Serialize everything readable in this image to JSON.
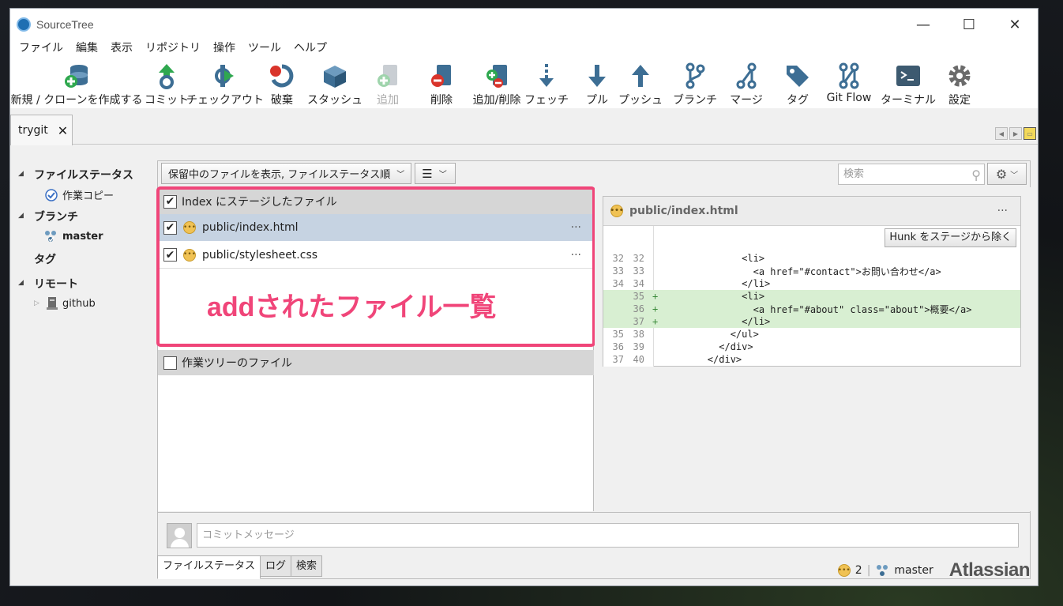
{
  "window": {
    "title": "SourceTree",
    "minimize": "—",
    "maximize": "☐",
    "close": "✕"
  },
  "menu": [
    "ファイル",
    "編集",
    "表示",
    "リポジトリ",
    "操作",
    "ツール",
    "ヘルプ"
  ],
  "toolbar": [
    {
      "label": "新規 / クローンを作成する",
      "icon": "database-plus-icon",
      "enabled": true
    },
    {
      "label": "コミット",
      "icon": "commit-icon",
      "enabled": true
    },
    {
      "label": "チェックアウト",
      "icon": "checkout-icon",
      "enabled": true
    },
    {
      "label": "破棄",
      "icon": "discard-icon",
      "enabled": true
    },
    {
      "label": "スタッシュ",
      "icon": "stash-box-icon",
      "enabled": true
    },
    {
      "label": "追加",
      "icon": "add-file-icon",
      "enabled": false
    },
    {
      "label": "削除",
      "icon": "remove-file-icon",
      "enabled": true
    },
    {
      "label": "追加/削除",
      "icon": "add-remove-icon",
      "enabled": true
    },
    {
      "label": "フェッチ",
      "icon": "fetch-icon",
      "enabled": true
    },
    {
      "label": "プル",
      "icon": "pull-arrow-icon",
      "enabled": true
    },
    {
      "label": "プッシュ",
      "icon": "push-arrow-icon",
      "enabled": true
    },
    {
      "label": "ブランチ",
      "icon": "branch-icon",
      "enabled": true
    },
    {
      "label": "マージ",
      "icon": "merge-icon",
      "enabled": true
    },
    {
      "label": "タグ",
      "icon": "tag-icon",
      "enabled": true
    },
    {
      "label": "Git Flow",
      "icon": "git-flow-icon",
      "enabled": true
    },
    {
      "label": "ターミナル",
      "icon": "terminal-icon",
      "enabled": true
    },
    {
      "label": "設定",
      "icon": "gear-icon",
      "enabled": true
    }
  ],
  "repo_tab": {
    "label": "trygit",
    "close": "✕"
  },
  "sidebar": {
    "file_status": "ファイルステータス",
    "working_copy": "作業コピー",
    "branches": "ブランチ",
    "master": "master",
    "tags": "タグ",
    "remotes": "リモート",
    "github": "github"
  },
  "filter": {
    "view_select": "保留中のファイルを表示, ファイルステータス順",
    "search_placeholder": "検索"
  },
  "staged": {
    "header": "Index にステージしたファイル",
    "files": [
      {
        "name": "public/index.html",
        "checked": "✔",
        "more": "···"
      },
      {
        "name": "public/stylesheet.css",
        "checked": "✔",
        "more": "···"
      }
    ]
  },
  "annotation": "addされたファイル一覧",
  "unstaged": {
    "header": "作業ツリーのファイル"
  },
  "diff": {
    "file": "public/index.html",
    "more": "···",
    "hunk_button": "Hunk をステージから除く",
    "lines": [
      {
        "old": "32",
        "new": "32",
        "mark": "",
        "text": "              <li>",
        "added": false
      },
      {
        "old": "33",
        "new": "33",
        "mark": "",
        "text": "                <a href=\"#contact\">お問い合わせ</a>",
        "added": false
      },
      {
        "old": "34",
        "new": "34",
        "mark": "",
        "text": "              </li>",
        "added": false
      },
      {
        "old": "",
        "new": "35",
        "mark": "+",
        "text": "              <li>",
        "added": true
      },
      {
        "old": "",
        "new": "36",
        "mark": "+",
        "text": "                <a href=\"#about\" class=\"about\">概要</a>",
        "added": true
      },
      {
        "old": "",
        "new": "37",
        "mark": "+",
        "text": "              </li>",
        "added": true
      },
      {
        "old": "35",
        "new": "38",
        "mark": "",
        "text": "            </ul>",
        "added": false
      },
      {
        "old": "36",
        "new": "39",
        "mark": "",
        "text": "          </div>",
        "added": false
      },
      {
        "old": "37",
        "new": "40",
        "mark": "",
        "text": "        </div>",
        "added": false
      }
    ]
  },
  "commit": {
    "placeholder": "コミットメッセージ"
  },
  "bottom_tabs": [
    "ファイルステータス",
    "ログ",
    "検索"
  ],
  "status": {
    "modified_count": "2",
    "branch": "master",
    "brand": "Atlassian"
  },
  "colors": {
    "highlight": "#f04579",
    "added_line": "#d8efd2",
    "selected_row": "#c6d3e2"
  }
}
